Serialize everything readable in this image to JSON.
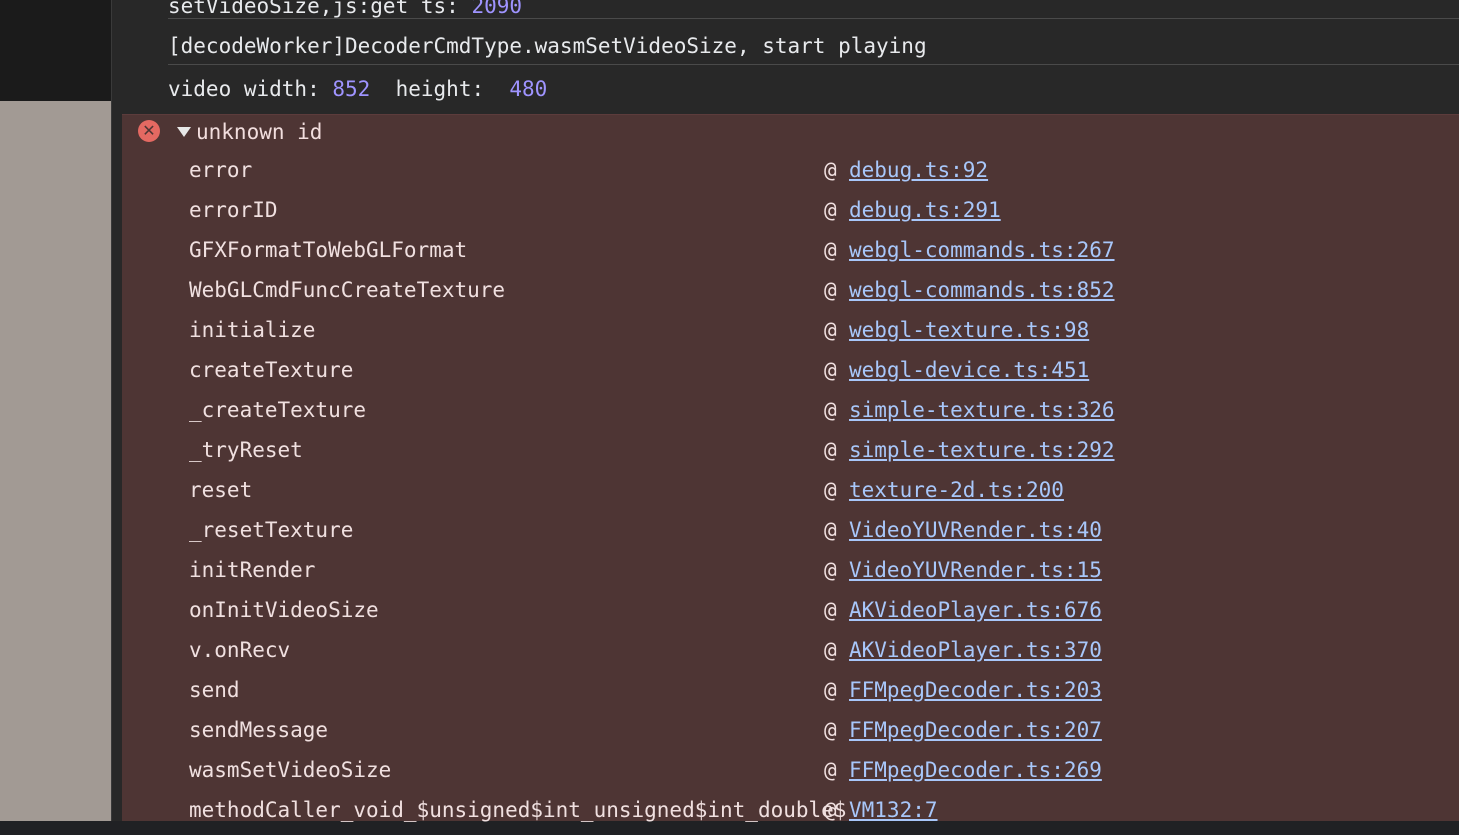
{
  "logs": [
    {
      "text": "setVideoSize,js:get ts: ",
      "num": "2090"
    },
    {
      "text": "[decodeWorker]DecoderCmdType.wasmSetVideoSize, start playing"
    },
    {
      "text_a": "video width: ",
      "num_a": "852",
      "text_b": "  height:  ",
      "num_b": "480"
    }
  ],
  "error": {
    "icon": "error-circle-icon",
    "title": "unknown id",
    "at_symbol": "@",
    "frames": [
      {
        "fn": "error",
        "src": "debug.ts:92"
      },
      {
        "fn": "errorID",
        "src": "debug.ts:291"
      },
      {
        "fn": "GFXFormatToWebGLFormat",
        "src": "webgl-commands.ts:267"
      },
      {
        "fn": "WebGLCmdFuncCreateTexture",
        "src": "webgl-commands.ts:852"
      },
      {
        "fn": "initialize",
        "src": "webgl-texture.ts:98"
      },
      {
        "fn": "createTexture",
        "src": "webgl-device.ts:451"
      },
      {
        "fn": "_createTexture",
        "src": "simple-texture.ts:326"
      },
      {
        "fn": "_tryReset",
        "src": "simple-texture.ts:292"
      },
      {
        "fn": "reset",
        "src": "texture-2d.ts:200"
      },
      {
        "fn": "_resetTexture",
        "src": "VideoYUVRender.ts:40"
      },
      {
        "fn": "initRender",
        "src": "VideoYUVRender.ts:15"
      },
      {
        "fn": "onInitVideoSize",
        "src": "AKVideoPlayer.ts:676"
      },
      {
        "fn": "v.onRecv",
        "src": "AKVideoPlayer.ts:370"
      },
      {
        "fn": "send",
        "src": "FFMpegDecoder.ts:203"
      },
      {
        "fn": "sendMessage",
        "src": "FFMpegDecoder.ts:207"
      },
      {
        "fn": "wasmSetVideoSize",
        "src": "FFMpegDecoder.ts:269"
      },
      {
        "fn": "methodCaller_void_$unsigned$int_unsigned$int_double$",
        "src": "VM132:7"
      }
    ]
  }
}
